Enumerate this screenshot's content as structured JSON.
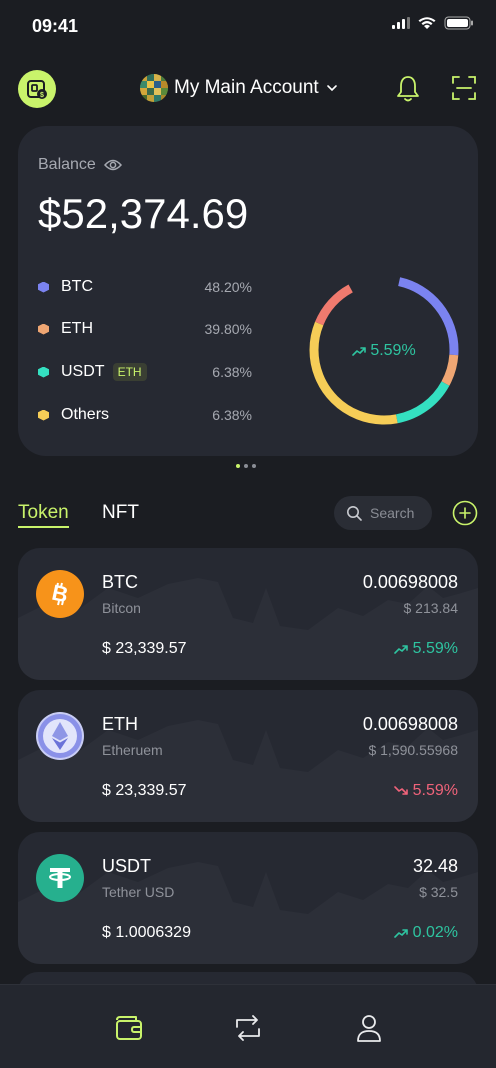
{
  "status": {
    "time": "09:41"
  },
  "header": {
    "account_name": "My Main Account"
  },
  "balance": {
    "label": "Balance",
    "value": "$52,374.69",
    "change": "5.59%",
    "allocations": [
      {
        "name": "BTC",
        "percent": "48.20%",
        "color": "#7b83f0",
        "fraction": 0.482
      },
      {
        "name": "ETH",
        "percent": "39.80%",
        "color": "#efa673",
        "fraction": 0.398,
        "tag": ""
      },
      {
        "name": "USDT",
        "percent": "6.38%",
        "color": "#34e0c1",
        "fraction": 0.0638,
        "tag": "ETH"
      },
      {
        "name": "Others",
        "percent": "6.38%",
        "color": "#f6cd57",
        "fraction": 0.0638
      }
    ]
  },
  "tabs": {
    "token": "Token",
    "nft": "NFT"
  },
  "search": {
    "placeholder": "Search"
  },
  "tokens": [
    {
      "symbol": "BTC",
      "name": "Bitcon",
      "amount": "0.00698008",
      "fiat": "$ 213.84",
      "price": "$ 23,339.57",
      "change": "5.59%",
      "direction": "up",
      "icon": "bitcoin-icon"
    },
    {
      "symbol": "ETH",
      "name": "Etheruem",
      "amount": "0.00698008",
      "fiat": "$ 1,590.55968",
      "price": "$ 23,339.57",
      "change": "5.59%",
      "direction": "down",
      "icon": "ethereum-icon"
    },
    {
      "symbol": "USDT",
      "name": "Tether USD",
      "amount": "32.48",
      "fiat": "$ 32.5",
      "price": "$ 1.0006329",
      "change": "0.02%",
      "direction": "up",
      "icon": "tether-icon"
    }
  ],
  "colors": {
    "accent": "#c9f36b",
    "up": "#2ec4a0",
    "down": "#f0637a"
  }
}
